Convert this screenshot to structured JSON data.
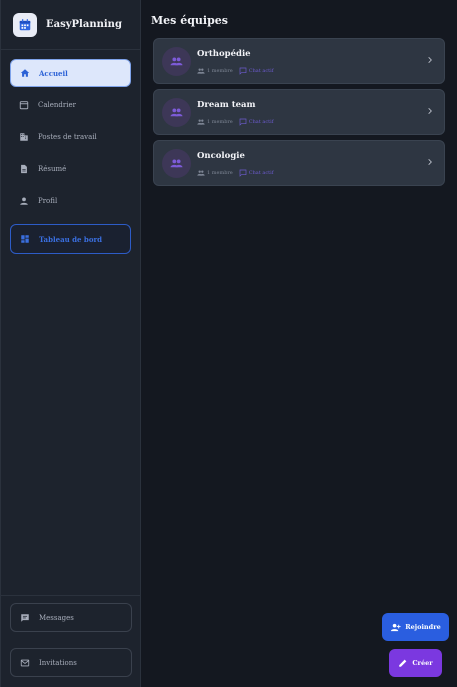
{
  "app": {
    "name": "EasyPlanning",
    "logo_icon": "calendar-icon",
    "logo_color": "#2f66e0"
  },
  "sidebar": {
    "items": [
      {
        "label": "Accueil",
        "icon": "home-icon",
        "active": true
      },
      {
        "label": "Calendrier",
        "icon": "calendar-icon"
      },
      {
        "label": "Postes de travail",
        "icon": "building-icon"
      },
      {
        "label": "Résumé",
        "icon": "document-icon"
      },
      {
        "label": "Profil",
        "icon": "person-icon"
      },
      {
        "label": "Tableau de bord",
        "icon": "dashboard-icon",
        "highlight": true
      }
    ],
    "bottom": [
      {
        "label": "Messages",
        "icon": "message-icon"
      },
      {
        "label": "Invitations",
        "icon": "mail-icon"
      }
    ]
  },
  "main": {
    "title": "Mes équipes",
    "teams": [
      {
        "name": "Orthopédie",
        "members": "1 membre",
        "chat": "Chat actif"
      },
      {
        "name": "Dream team",
        "members": "1 membre",
        "chat": "Chat actif"
      },
      {
        "name": "Oncologie",
        "members": "1 membre",
        "chat": "Chat actif"
      }
    ]
  },
  "actions": {
    "join_label": "Rejoindre",
    "create_label": "Créer"
  },
  "colors": {
    "accent_blue": "#2a5ee0",
    "accent_purple": "#7b38e0",
    "background": "#141820",
    "sidebar": "#1d232d"
  }
}
